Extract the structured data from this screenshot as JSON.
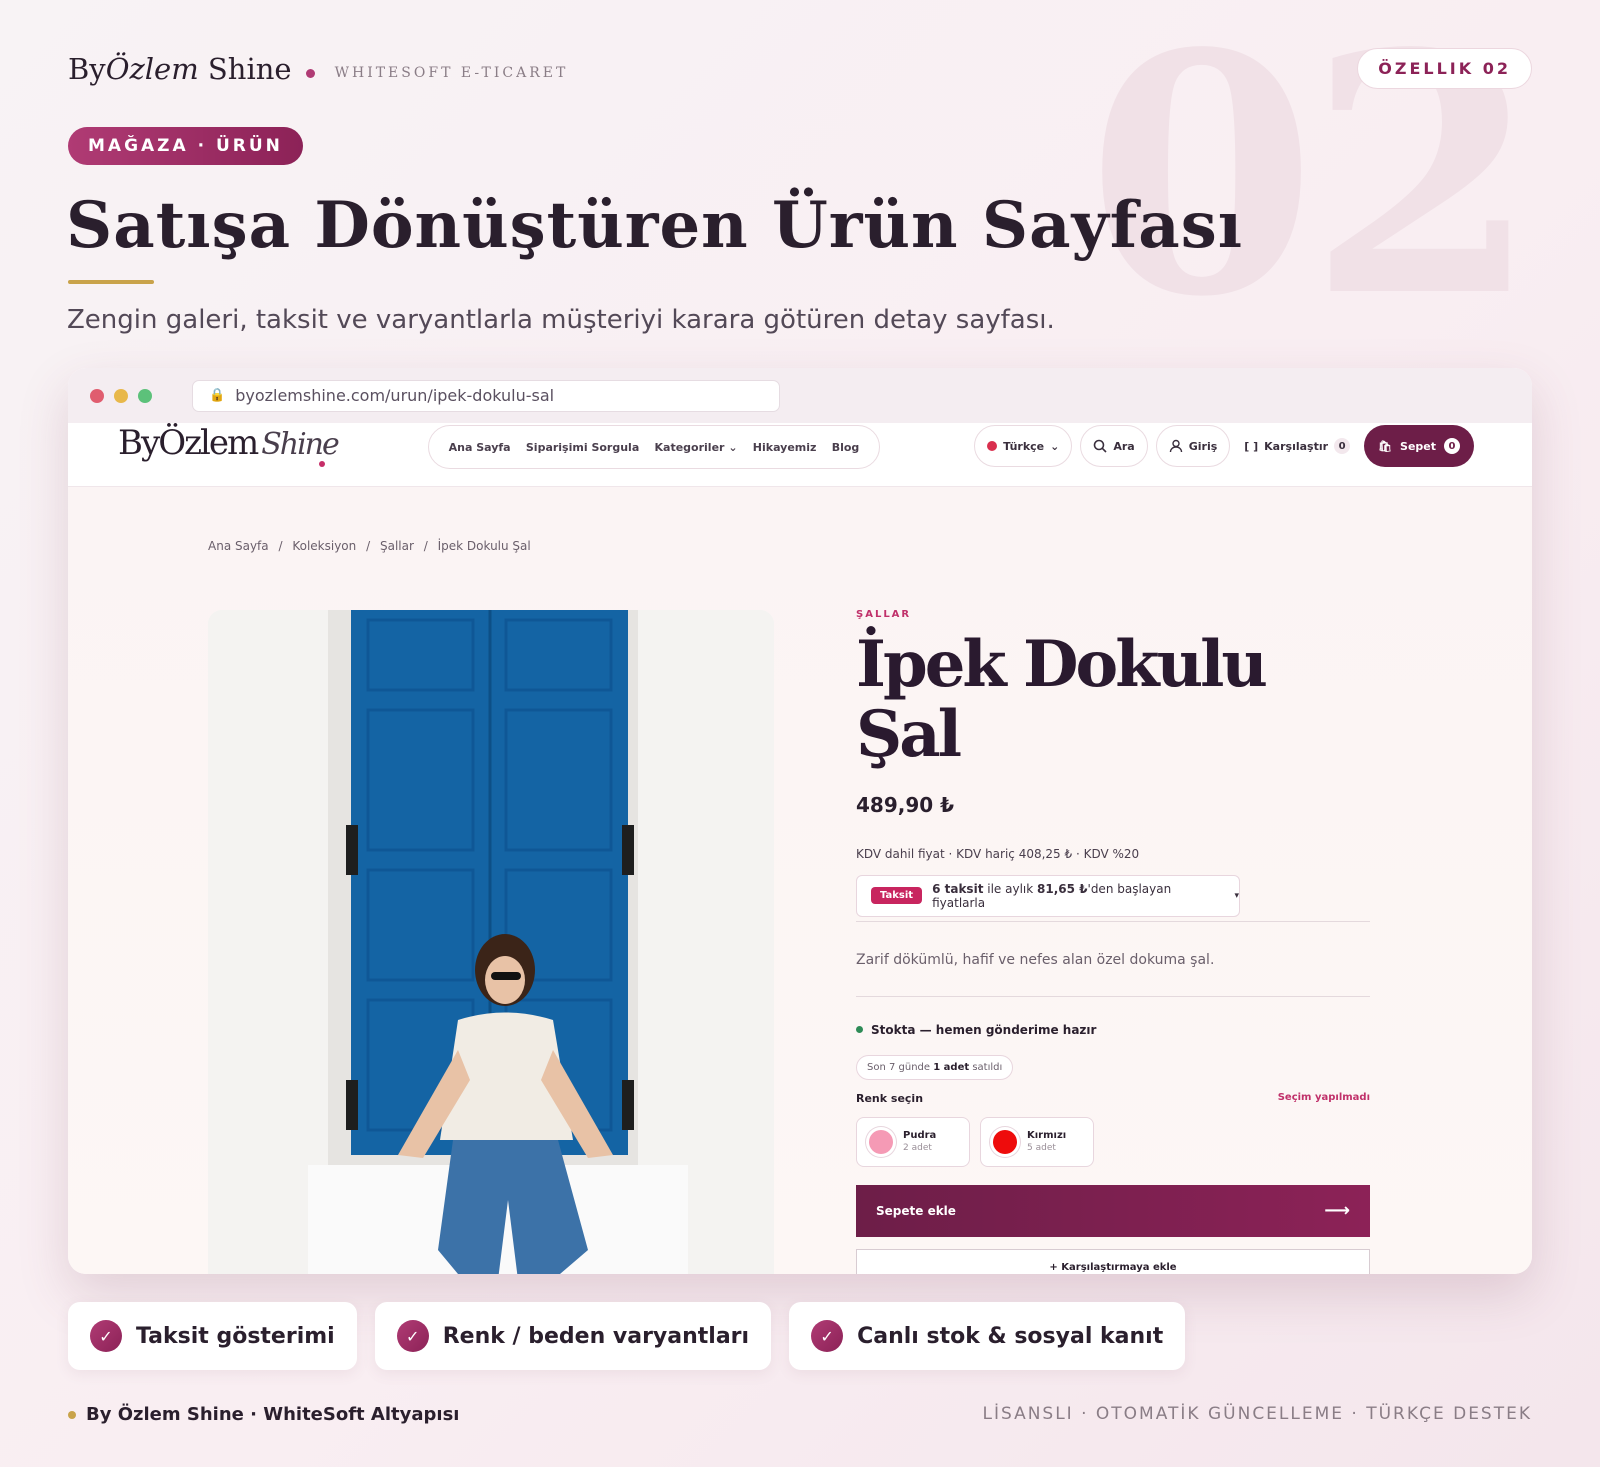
{
  "header": {
    "brand_prefix": "By",
    "brand_italic": "Özlem",
    "brand_suffix": "Shine",
    "subbrand": "WHITESOFT E-TICARET",
    "feature_label": "ÖZELLIK 02",
    "big_number": "02"
  },
  "hero": {
    "tag": "MAĞAZA · ÜRÜN",
    "title": "Satışa Dönüştüren Ürün Sayfası",
    "subtitle": "Zengin galeri, taksit ve varyantlarla müşteriyi karara götüren detay sayfası."
  },
  "browser": {
    "url": "byozlemshine.com/urun/ipek-dokulu-sal"
  },
  "site": {
    "logo_text": "ByÖzlem",
    "logo_script": "Shine",
    "menu": [
      "Ana Sayfa",
      "Siparişimi Sorgula",
      "Kategoriler",
      "Hikayemiz",
      "Blog"
    ],
    "language": "Türkçe",
    "search": "Ara",
    "login": "Giriş",
    "compare": "Karşılaştır",
    "compare_count": "0",
    "cart": "Sepet",
    "cart_count": "0"
  },
  "breadcrumb": [
    "Ana Sayfa",
    "/",
    "Koleksiyon",
    "/",
    "Şallar",
    "/",
    "İpek Dokulu Şal"
  ],
  "product": {
    "category": "ŞALLAR",
    "name": "İpek Dokulu Şal",
    "price": "489,90 ₺",
    "kdv": "KDV dahil fiyat · KDV hariç 408,25 ₺ · KDV %20",
    "installment_badge": "Taksit",
    "installment_count": "6 taksit",
    "installment_mid": "ile aylık",
    "installment_amount": "81,65 ₺",
    "installment_end": "'den başlayan fiyatlarla",
    "description": "Zarif dökümlü, hafif ve nefes alan özel dokuma şal.",
    "stock": "Stokta — hemen gönderime hazır",
    "sold_prefix": "Son 7 günde",
    "sold_bold": "1 adet",
    "sold_suffix": "satıldı",
    "color_label": "Renk seçin",
    "color_warning": "Seçim yapılmadı",
    "colors": [
      {
        "name": "Pudra",
        "stock": "2 adet",
        "hex": "#f59ab5"
      },
      {
        "name": "Kırmızı",
        "stock": "5 adet",
        "hex": "#ee0c0c"
      }
    ],
    "add_to_cart": "Sepete ekle",
    "add_to_compare": "+ Karşılaştırmaya ekle"
  },
  "features": [
    "Taksit gösterimi",
    "Renk / beden varyantları",
    "Canlı stok & sosyal kanıt"
  ],
  "footer": {
    "left": "By Özlem Shine · WhiteSoft Altyapısı",
    "right": "LİSANSLI · OTOMATİK GÜNCELLEME · TÜRKÇE DESTEK"
  },
  "colors": {
    "accent": "#8c2257",
    "accent_light": "#b03b74",
    "gold": "#c9a34a",
    "door_blue": "#1464a4"
  }
}
